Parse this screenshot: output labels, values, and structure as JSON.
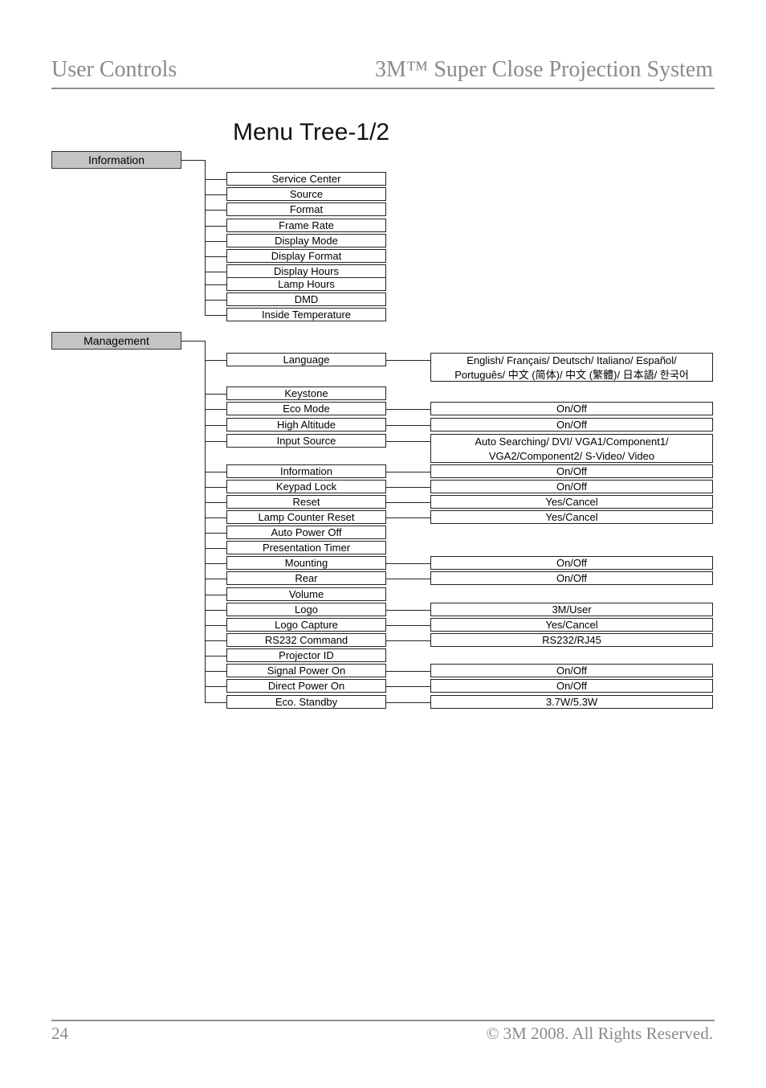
{
  "header": {
    "section": "User Controls",
    "product": "3M™ Super Close Projection System"
  },
  "page_title": "Menu Tree-1/2",
  "footer": {
    "page_number": "24",
    "copyright": "© 3M 2008.  All Rights Reserved."
  },
  "menu_tree": [
    {
      "category": "Information",
      "items": [
        {
          "label": "Service Center",
          "options": null
        },
        {
          "label": "Source",
          "options": null
        },
        {
          "label": "Format",
          "options": null
        },
        {
          "label": "Frame Rate",
          "options": null
        },
        {
          "label": "Display Mode",
          "options": null
        },
        {
          "label": "Display Format",
          "options": null
        },
        {
          "label": "Display Hours",
          "options": null
        },
        {
          "label": "Lamp Hours",
          "options": null
        },
        {
          "label": "DMD",
          "options": null
        },
        {
          "label": "Inside Temperature",
          "options": null
        }
      ]
    },
    {
      "category": "Management",
      "items": [
        {
          "label": "Language",
          "options": "English/ Français/ Deutsch/ Italiano/ Español/ Português/ 中文 (简体)/ 中文 (繁體)/ 日本語/ 한국어"
        },
        {
          "label": "Keystone",
          "options": null
        },
        {
          "label": "Eco Mode",
          "options": "On/Off"
        },
        {
          "label": "High Altitude",
          "options": "On/Off"
        },
        {
          "label": "Input Source",
          "options": "Auto Searching/ DVI/ VGA1/Component1/ VGA2/Component2/ S-Video/ Video"
        },
        {
          "label": "Information",
          "options": "On/Off"
        },
        {
          "label": "Keypad Lock",
          "options": "On/Off"
        },
        {
          "label": "Reset",
          "options": "Yes/Cancel"
        },
        {
          "label": "Lamp Counter Reset",
          "options": "Yes/Cancel"
        },
        {
          "label": "Auto Power Off",
          "options": null
        },
        {
          "label": "Presentation Timer",
          "options": null
        },
        {
          "label": "Mounting",
          "options": "On/Off"
        },
        {
          "label": "Rear",
          "options": "On/Off"
        },
        {
          "label": "Volume",
          "options": null
        },
        {
          "label": "Logo",
          "options": "3M/User"
        },
        {
          "label": "Logo Capture",
          "options": "Yes/Cancel"
        },
        {
          "label": "RS232 Command",
          "options": "RS232/RJ45"
        },
        {
          "label": "Projector ID",
          "options": null
        },
        {
          "label": "Signal Power On",
          "options": "On/Off"
        },
        {
          "label": "Direct Power On",
          "options": "On/Off"
        },
        {
          "label": "Eco. Standby",
          "options": "3.7W/5.3W"
        }
      ]
    }
  ]
}
